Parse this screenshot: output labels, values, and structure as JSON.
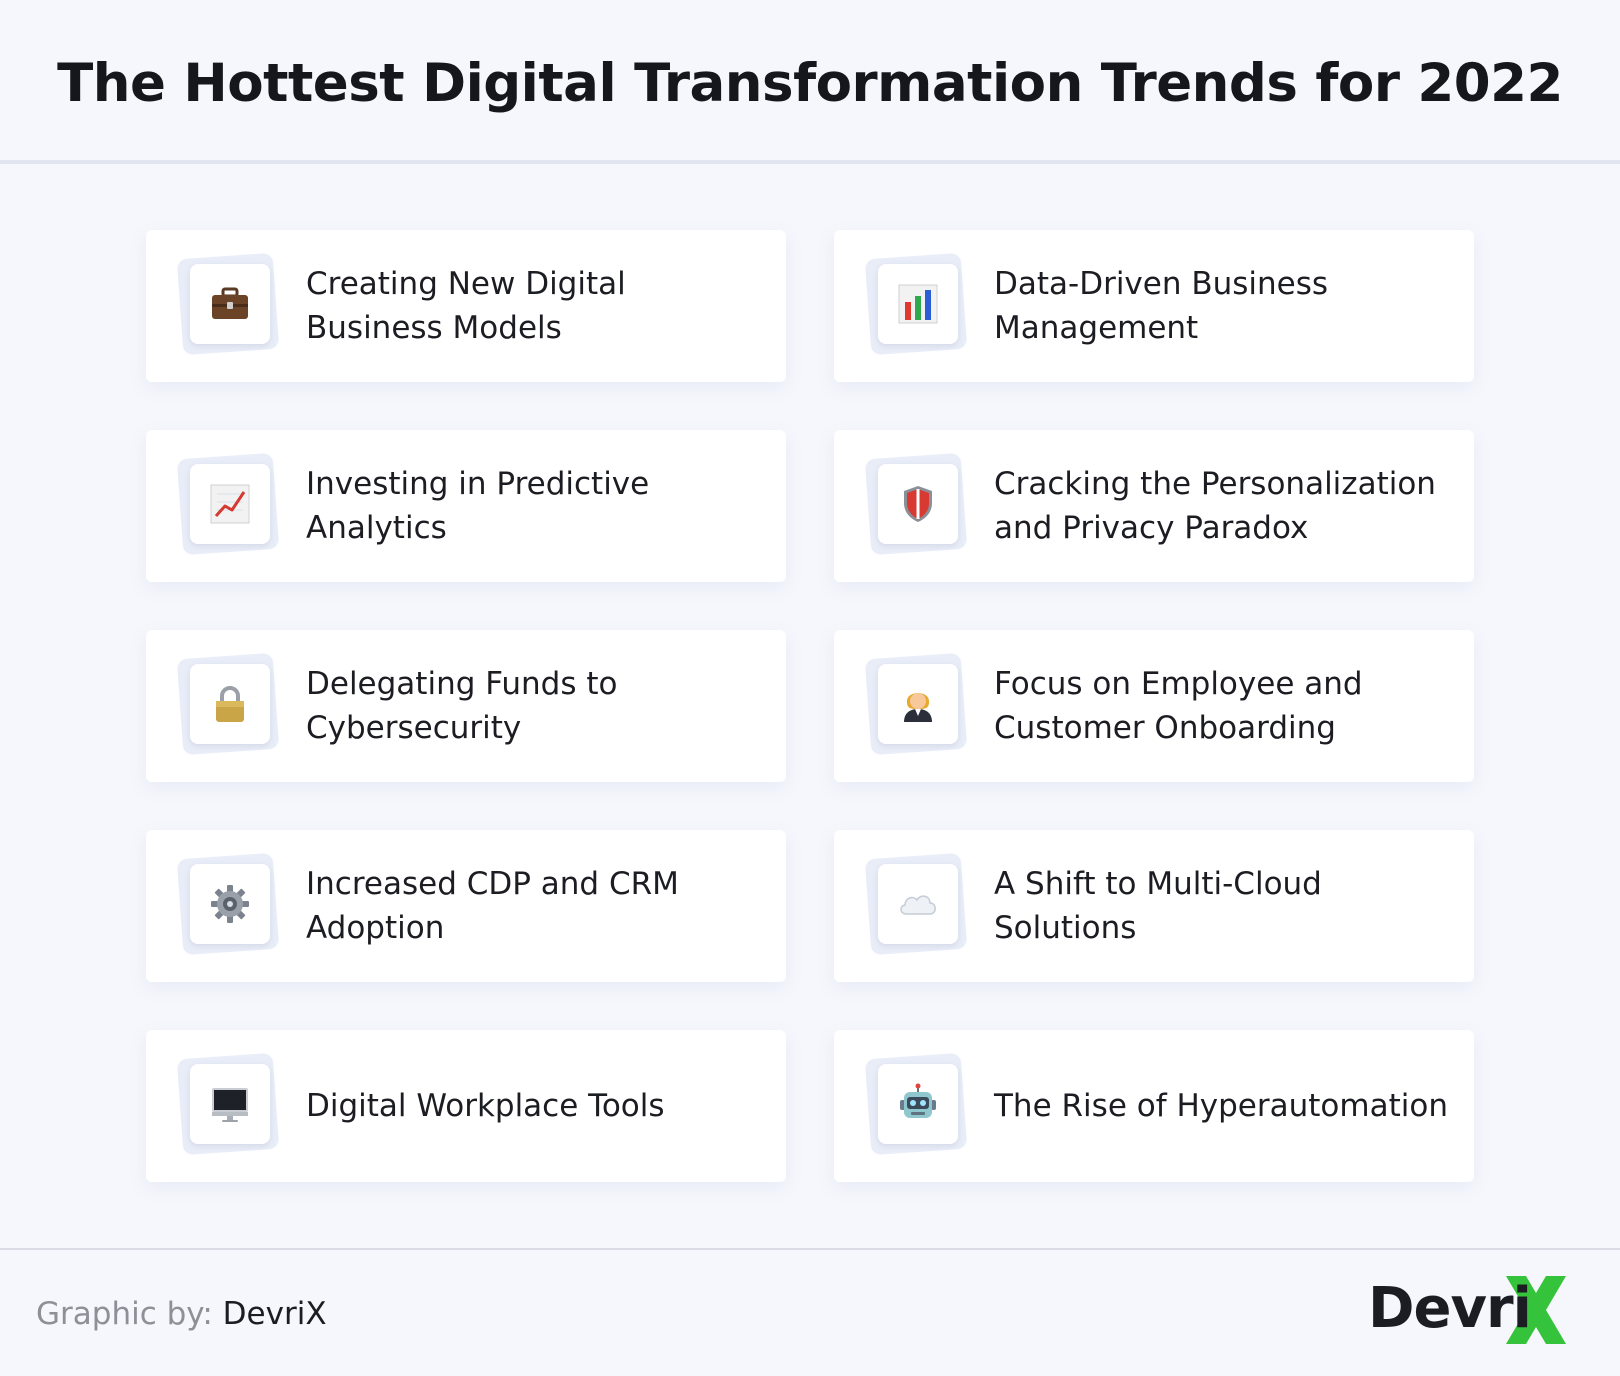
{
  "header": {
    "title": "The Hottest Digital Transformation Trends for 2022"
  },
  "trends": [
    {
      "label": "Creating New Digital Business Models",
      "icon": "briefcase-icon"
    },
    {
      "label": "Data-Driven Business Management",
      "icon": "bar-chart-icon"
    },
    {
      "label": "Investing in Predictive Analytics",
      "icon": "trend-chart-icon"
    },
    {
      "label": "Cracking the Personalization and Privacy Paradox",
      "icon": "shield-icon"
    },
    {
      "label": "Delegating Funds to Cybersecurity",
      "icon": "padlock-icon"
    },
    {
      "label": "Focus on Employee and Customer Onboarding",
      "icon": "person-icon"
    },
    {
      "label": "Increased CDP and CRM Adoption",
      "icon": "gear-icon"
    },
    {
      "label": "A Shift to Multi-Cloud Solutions",
      "icon": "cloud-icon"
    },
    {
      "label": "Digital Workplace Tools",
      "icon": "desktop-icon"
    },
    {
      "label": "The Rise of Hyperautomation",
      "icon": "robot-icon"
    }
  ],
  "footer": {
    "credit_prefix": "Graphic by: ",
    "credit_brand": "DevriX",
    "logo_text": "Devri"
  },
  "colors": {
    "background": "#f5f7fc",
    "card": "#ffffff",
    "logo_accent": "#35c33b"
  }
}
